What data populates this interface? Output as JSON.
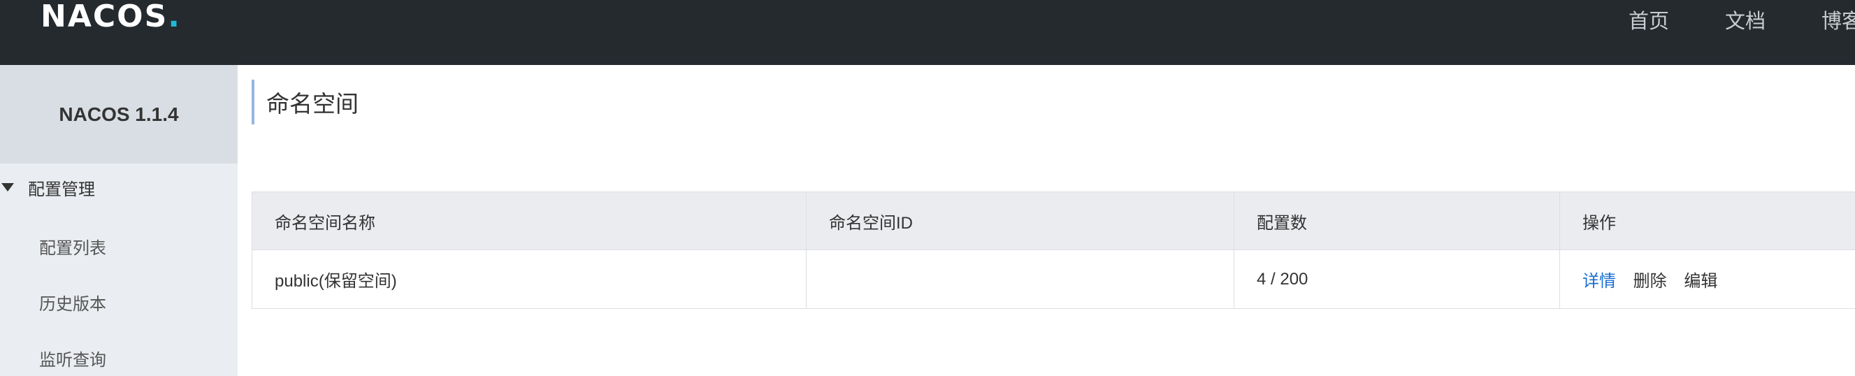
{
  "header": {
    "logo_text": "NACOS",
    "logo_dot": ".",
    "nav": [
      {
        "label": "首页"
      },
      {
        "label": "文档"
      },
      {
        "label": "博客"
      }
    ]
  },
  "sidebar": {
    "title": "NACOS 1.1.4",
    "group_label": "配置管理",
    "items": [
      {
        "label": "配置列表"
      },
      {
        "label": "历史版本"
      },
      {
        "label": "监听查询"
      }
    ]
  },
  "main": {
    "page_title": "命名空间",
    "table": {
      "columns": [
        "命名空间名称",
        "命名空间ID",
        "配置数",
        "操作"
      ],
      "rows": [
        {
          "name": "public(保留空间)",
          "id": "",
          "config_count": "4 / 200",
          "actions": [
            "详情",
            "删除",
            "编辑"
          ]
        }
      ]
    }
  },
  "colors": {
    "header_bg": "#252a2f",
    "sidebar_bg": "#eaedf1",
    "link_blue": "#1a6ed1",
    "title_accent": "#93b7e2"
  }
}
